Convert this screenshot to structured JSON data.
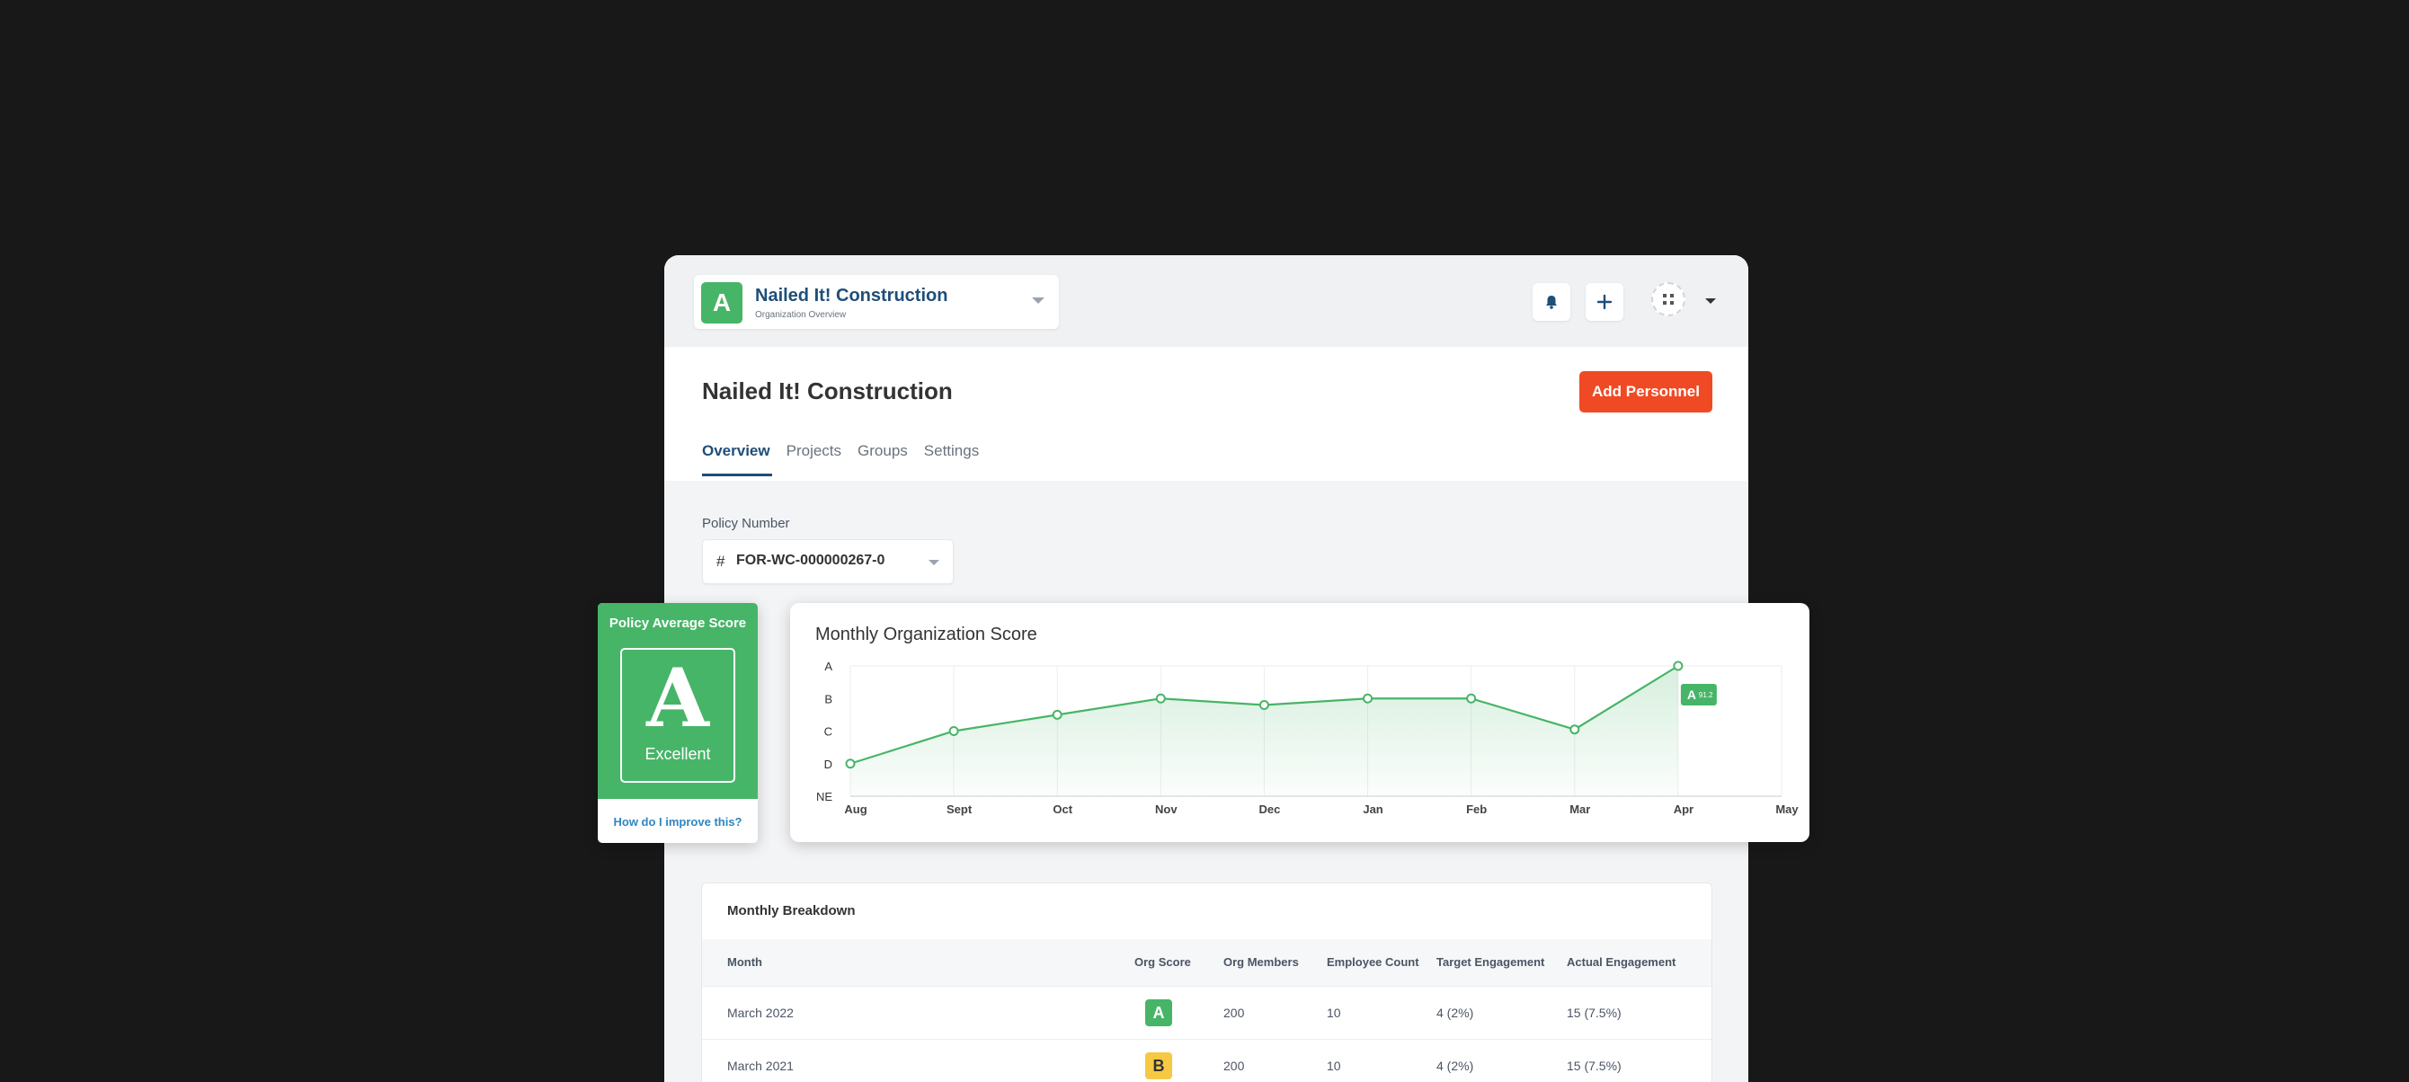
{
  "org": {
    "logo_letter": "A",
    "name": "Nailed It! Construction",
    "subtitle": "Organization Overview"
  },
  "header": {
    "title": "Nailed It! Construction",
    "add_button": "Add Personnel"
  },
  "tabs": [
    {
      "label": "Overview",
      "active": true
    },
    {
      "label": "Projects",
      "active": false
    },
    {
      "label": "Groups",
      "active": false
    },
    {
      "label": "Settings",
      "active": false
    }
  ],
  "policy": {
    "label": "Policy Number",
    "prefix": "#",
    "value": "FOR-WC-000000267-0"
  },
  "score_card": {
    "title": "Policy Average Score",
    "letter": "A",
    "word": "Excellent",
    "link": "How do I improve this?"
  },
  "chart_data": {
    "type": "area",
    "title": "Monthly Organization Score",
    "y_ticks": [
      "A",
      "B",
      "C",
      "D",
      "NE"
    ],
    "categories": [
      "Aug",
      "Sept",
      "Oct",
      "Nov",
      "Dec",
      "Jan",
      "Feb",
      "Mar",
      "Apr",
      "May"
    ],
    "values": [
      1.0,
      2.0,
      2.5,
      3.0,
      2.8,
      3.0,
      3.0,
      2.05,
      4.0,
      null
    ],
    "ylim": [
      0,
      4
    ],
    "grid": true,
    "annotation": {
      "label": "A",
      "value": "91.2",
      "at": "Apr"
    },
    "colors": {
      "line": "#47b567",
      "fill": "#47b567"
    }
  },
  "breakdown": {
    "title": "Monthly Breakdown",
    "columns": [
      "Month",
      "Org Score",
      "Org Members",
      "Employee Count",
      "Target Engagement",
      "Actual Engagement"
    ],
    "rows": [
      {
        "month": "March 2022",
        "grade": "A",
        "members": "200",
        "employees": "10",
        "target": "4 (2%)",
        "actual": "15 (7.5%)"
      },
      {
        "month": "March 2021",
        "grade": "B",
        "members": "200",
        "employees": "10",
        "target": "4 (2%)",
        "actual": "15 (7.5%)"
      }
    ]
  },
  "colors": {
    "brand_green": "#47b567",
    "accent_orange": "#f04a24",
    "navy": "#1f4e79",
    "grade_b": "#f6c944"
  }
}
